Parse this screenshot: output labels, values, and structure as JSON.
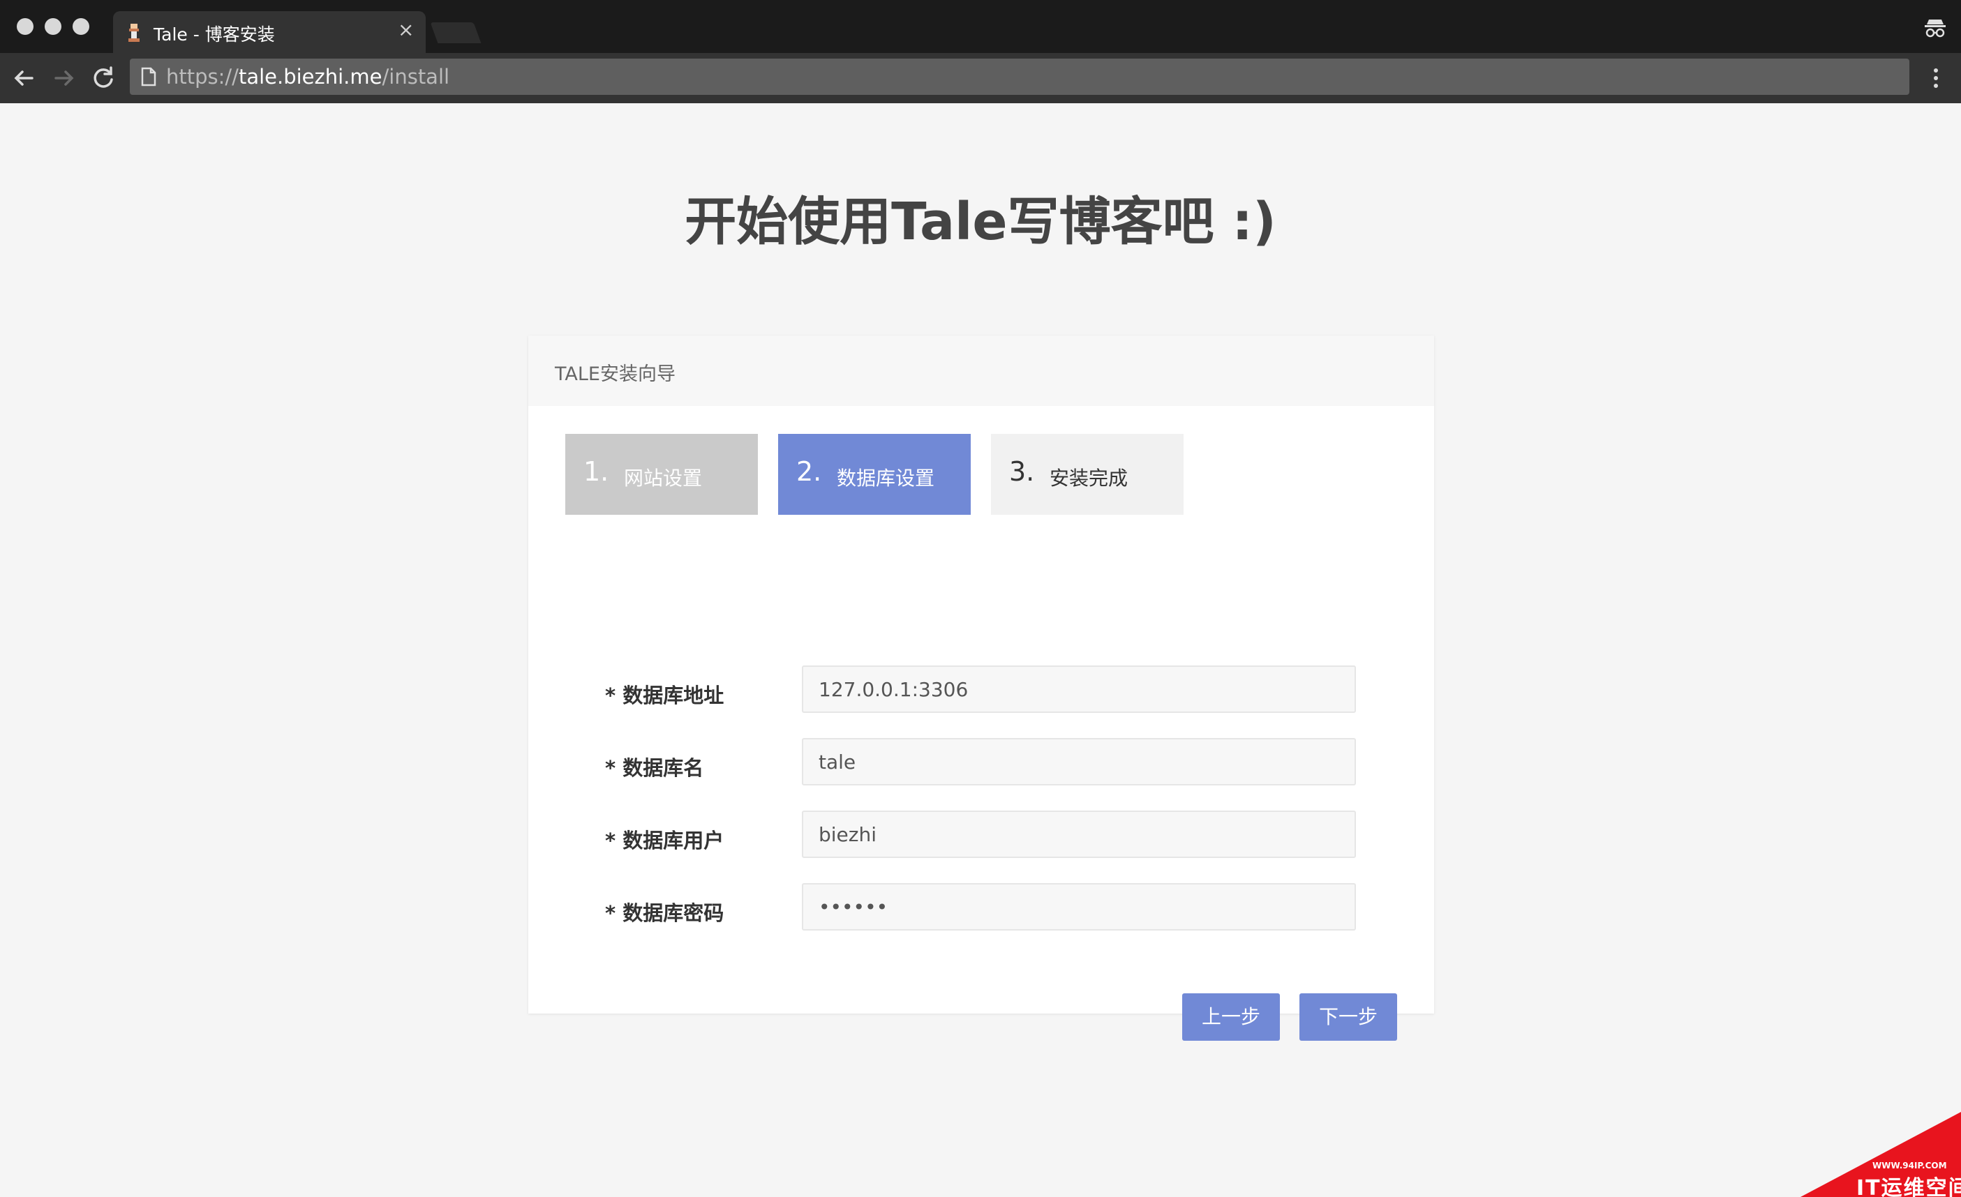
{
  "browser": {
    "tab_title": "Tale - 博客安装",
    "tab_close": "×",
    "url_scheme": "https://",
    "url_host": "tale.biezhi.me",
    "url_path": "/install"
  },
  "page": {
    "title": "开始使用Tale写博客吧 :)"
  },
  "wizard": {
    "header": "TALE安装向导",
    "steps": [
      {
        "number": "1.",
        "label": "网站设置",
        "state": "done"
      },
      {
        "number": "2.",
        "label": "数据库设置",
        "state": "active"
      },
      {
        "number": "3.",
        "label": "安装完成",
        "state": "pending"
      }
    ],
    "fields": [
      {
        "label": "* 数据库地址",
        "value": "127.0.0.1:3306"
      },
      {
        "label": "* 数据库名",
        "value": "tale"
      },
      {
        "label": "* 数据库用户",
        "value": "biezhi"
      },
      {
        "label": "* 数据库密码",
        "value": "••••••"
      }
    ],
    "prev_button": "上一步",
    "next_button": "下一步"
  },
  "watermark": {
    "small": "WWW.94IP.COM",
    "big": "IT运维空间"
  },
  "colors": {
    "accent": "#7189d6",
    "step_done": "#cacaca",
    "step_pending": "#f1f1f1",
    "page_bg": "#f5f5f5",
    "watermark": "#e8141e"
  }
}
